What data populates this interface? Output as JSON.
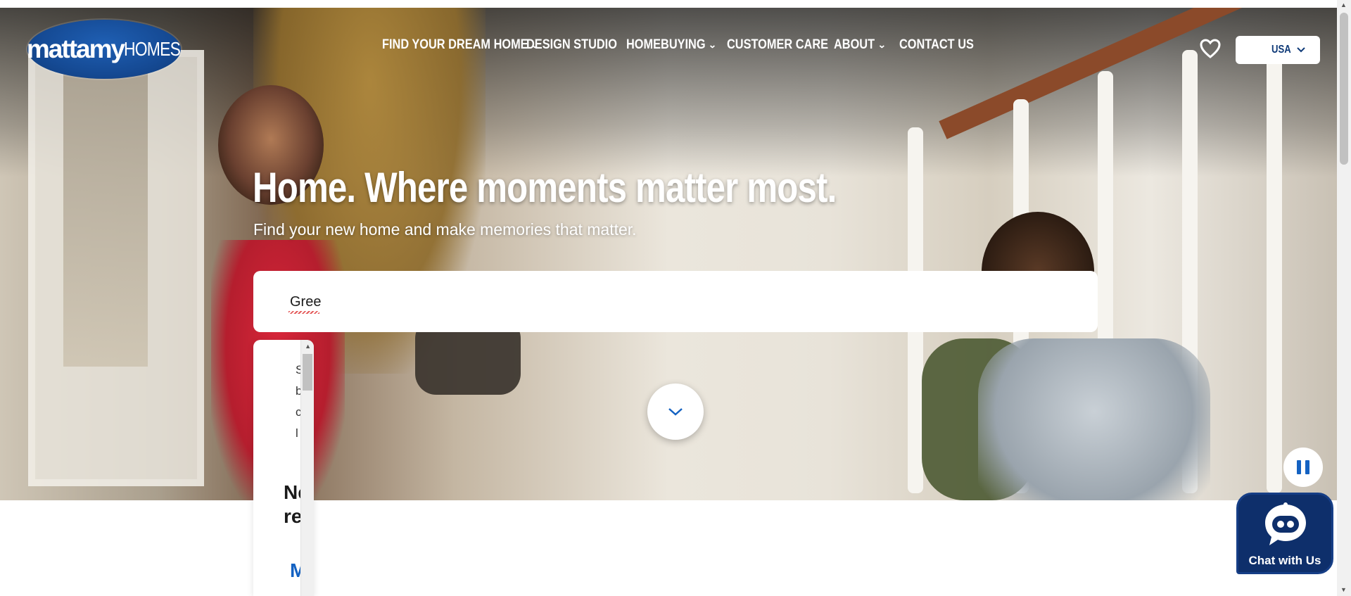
{
  "brand": {
    "logo_bold": "mattamy",
    "logo_light": "HOMES"
  },
  "nav": {
    "items": [
      {
        "label": "FIND YOUR DREAM HOME",
        "has_dropdown": true
      },
      {
        "label": "DESIGN STUDIO",
        "has_dropdown": false
      },
      {
        "label": "HOMEBUYING",
        "has_dropdown": true
      },
      {
        "label": "CUSTOMER CARE",
        "has_dropdown": false
      },
      {
        "label": "ABOUT",
        "has_dropdown": true
      },
      {
        "label": "CONTACT US",
        "has_dropdown": false
      }
    ]
  },
  "header": {
    "favorites_icon": "heart-icon",
    "country": "USA"
  },
  "hero": {
    "title": "Home. Where moments matter most.",
    "subtitle": "Find your new home and make memories that matter."
  },
  "search": {
    "value": "Gree"
  },
  "dropdown": {
    "letters": [
      "S",
      "b",
      "c",
      "l"
    ],
    "heading": "Ne res",
    "heading_line1": "Ne",
    "heading_line2": "res",
    "link": "M"
  },
  "controls": {
    "scroll_icon": "chevron-down-icon",
    "pause_icon": "pause-icon"
  },
  "chat": {
    "label": "Chat with Us",
    "icon": "chatbot-icon"
  },
  "colors": {
    "brand_blue": "#154a94",
    "accent_blue": "#1462c2",
    "chat_bg": "#0e2f6b"
  }
}
